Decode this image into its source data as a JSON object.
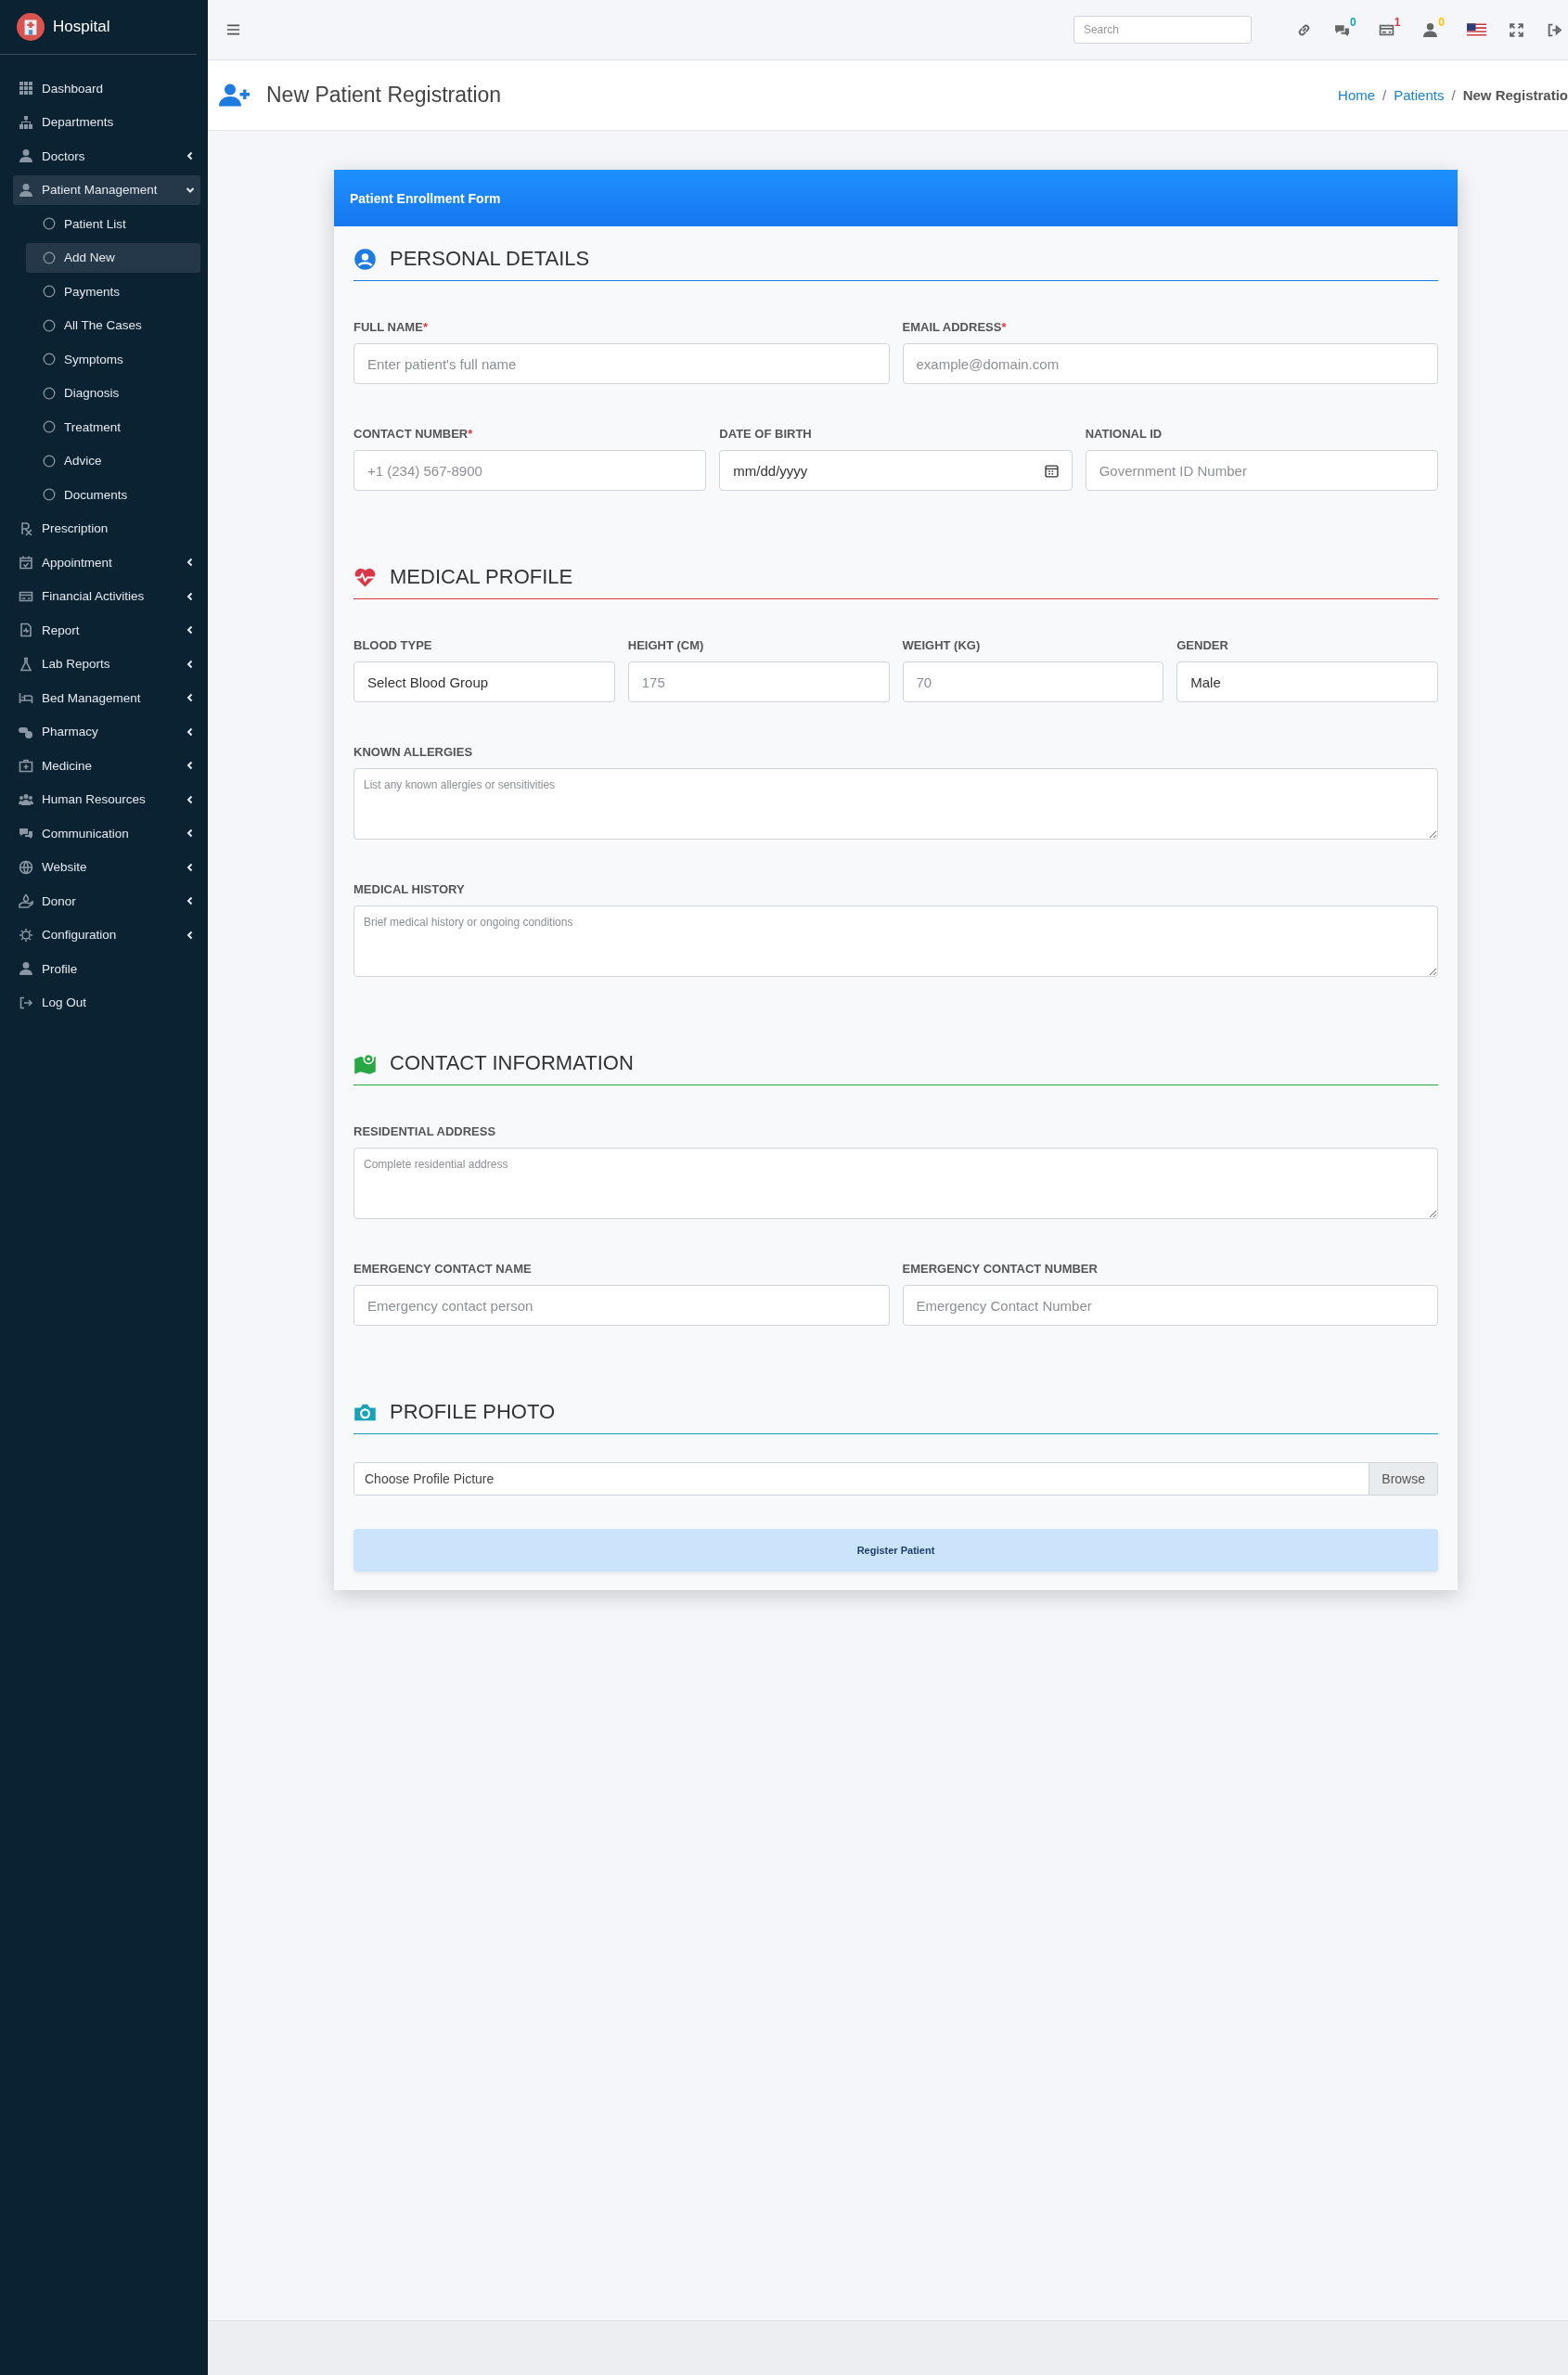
{
  "sidebar": {
    "brand": "Hospital",
    "items": [
      {
        "label": "Dashboard",
        "selected": false
      },
      {
        "label": "Departments",
        "selected": false
      },
      {
        "label": "Doctors",
        "selected": false,
        "expanded": false
      },
      {
        "label": "Patient Management",
        "selected": true,
        "expanded": true,
        "children": [
          {
            "label": "Patient List",
            "selected": false
          },
          {
            "label": "Add New",
            "selected": true
          },
          {
            "label": "Payments",
            "selected": false
          },
          {
            "label": "All The Cases",
            "selected": false
          },
          {
            "label": "Symptoms",
            "selected": false
          },
          {
            "label": "Diagnosis",
            "selected": false
          },
          {
            "label": "Treatment",
            "selected": false
          },
          {
            "label": "Advice",
            "selected": false
          },
          {
            "label": "Documents",
            "selected": false
          }
        ]
      },
      {
        "label": "Prescription",
        "selected": false
      },
      {
        "label": "Appointment",
        "selected": false,
        "expanded": false
      },
      {
        "label": "Financial Activities",
        "selected": false,
        "expanded": false
      },
      {
        "label": "Report",
        "selected": false,
        "expanded": false
      },
      {
        "label": "Lab Reports",
        "selected": false,
        "expanded": false
      },
      {
        "label": "Bed Management",
        "selected": false,
        "expanded": false
      },
      {
        "label": "Pharmacy",
        "selected": false,
        "expanded": false
      },
      {
        "label": "Medicine",
        "selected": false,
        "expanded": false
      },
      {
        "label": "Human Resources",
        "selected": false,
        "expanded": false
      },
      {
        "label": "Communication",
        "selected": false,
        "expanded": false
      },
      {
        "label": "Website",
        "selected": false,
        "expanded": false
      },
      {
        "label": "Donor",
        "selected": false,
        "expanded": false
      },
      {
        "label": "Configuration",
        "selected": false,
        "expanded": false
      },
      {
        "label": "Profile",
        "selected": false
      },
      {
        "label": "Log Out",
        "selected": false
      }
    ]
  },
  "topbar": {
    "search": {
      "placeholder": "Search"
    },
    "notifications": [
      {
        "badge": "0",
        "color": "#17a2b8"
      },
      {
        "badge": "1",
        "color": "#dc3545"
      },
      {
        "badge": "0",
        "color": "#ffc107"
      }
    ]
  },
  "page_header": {
    "title": "New Patient Registration",
    "separator": "/",
    "breadcrumb": [
      {
        "label": "Home",
        "current": false
      },
      {
        "label": "Patients",
        "current": false
      },
      {
        "label": "New Registratio",
        "current": true
      }
    ]
  },
  "form": {
    "title": "Patient Enrollment Form",
    "sections": [
      {
        "title": "PERSONAL DETAILS",
        "color": "#1e7be0",
        "rows": [
          [
            {
              "kind": "input",
              "label": "FULL NAME",
              "required_mark": "*",
              "placeholder": "Enter patient's full name"
            },
            {
              "kind": "input",
              "label": "EMAIL ADDRESS",
              "required_mark": "*",
              "placeholder": "example@domain.com"
            }
          ],
          [
            {
              "kind": "input",
              "label": "CONTACT NUMBER",
              "required_mark": "*",
              "placeholder": "+1 (234) 567-8900"
            },
            {
              "kind": "date",
              "label": "DATE OF BIRTH",
              "value": "mm/dd/yyyy"
            },
            {
              "kind": "input",
              "label": "NATIONAL ID",
              "placeholder": "Government ID Number"
            }
          ]
        ]
      },
      {
        "title": "MEDICAL PROFILE",
        "color": "#dc3545",
        "rows": [
          [
            {
              "kind": "select",
              "label": "BLOOD TYPE",
              "value": "Select Blood Group"
            },
            {
              "kind": "input",
              "label": "HEIGHT (CM)",
              "placeholder": "175"
            },
            {
              "kind": "input",
              "label": "WEIGHT (KG)",
              "placeholder": "70"
            },
            {
              "kind": "select",
              "label": "GENDER",
              "value": "Male"
            }
          ],
          [
            {
              "kind": "textarea",
              "label": "KNOWN ALLERGIES",
              "placeholder": "List any known allergies or sensitivities"
            }
          ],
          [
            {
              "kind": "textarea",
              "label": "MEDICAL HISTORY",
              "placeholder": "Brief medical history or ongoing conditions"
            }
          ]
        ]
      },
      {
        "title": "CONTACT INFORMATION",
        "color": "#28a745",
        "rows": [
          [
            {
              "kind": "textarea",
              "label": "RESIDENTIAL ADDRESS",
              "placeholder": "Complete residential address"
            }
          ],
          [
            {
              "kind": "input",
              "label": "EMERGENCY CONTACT NAME",
              "placeholder": "Emergency contact person"
            },
            {
              "kind": "input",
              "label": "EMERGENCY CONTACT NUMBER",
              "placeholder": "Emergency Contact Number"
            }
          ]
        ]
      },
      {
        "title": "PROFILE PHOTO",
        "color": "#17a2b8",
        "rows": [
          [
            {
              "kind": "file",
              "value": "Choose Profile Picture",
              "button": "Browse"
            }
          ]
        ]
      }
    ],
    "submit": "Register Patient"
  }
}
